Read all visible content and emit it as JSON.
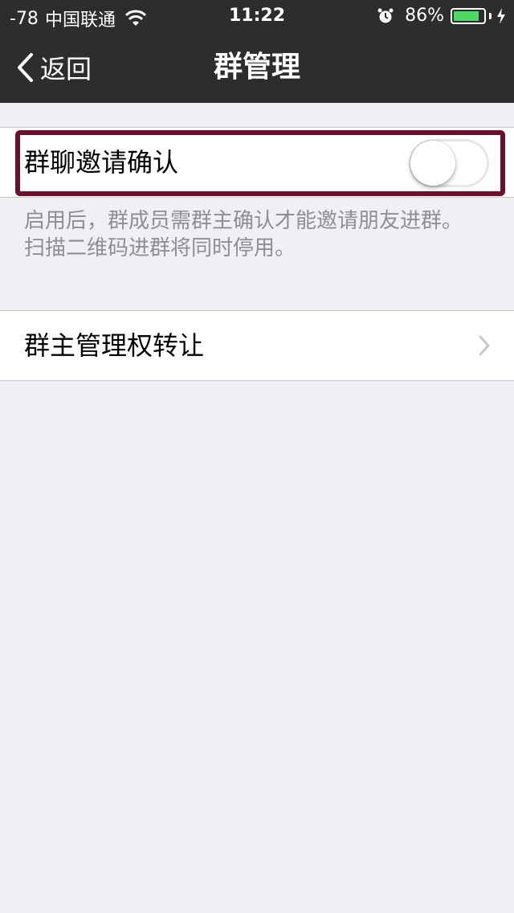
{
  "status_bar": {
    "signal": "-78",
    "carrier": "中国联通",
    "time": "11:22",
    "battery_percent": "86%",
    "battery_level": 0.86,
    "icons": [
      "wifi-icon",
      "alarm-icon",
      "battery-icon",
      "charging-icon"
    ]
  },
  "nav": {
    "back_label": "返回",
    "title": "群管理"
  },
  "settings": {
    "invite_confirm": {
      "label": "群聊邀请确认",
      "enabled": false
    },
    "invite_note": "启用后，群成员需群主确认才能邀请朋友进群。扫描二维码进群将同时停用。",
    "transfer_owner": {
      "label": "群主管理权转让"
    }
  },
  "colors": {
    "nav_background": "#2d2d30",
    "page_background": "#efeff4",
    "highlight_border": "#6d0f2a",
    "battery_fill": "#4cd964",
    "note_text": "#8e8e93"
  }
}
